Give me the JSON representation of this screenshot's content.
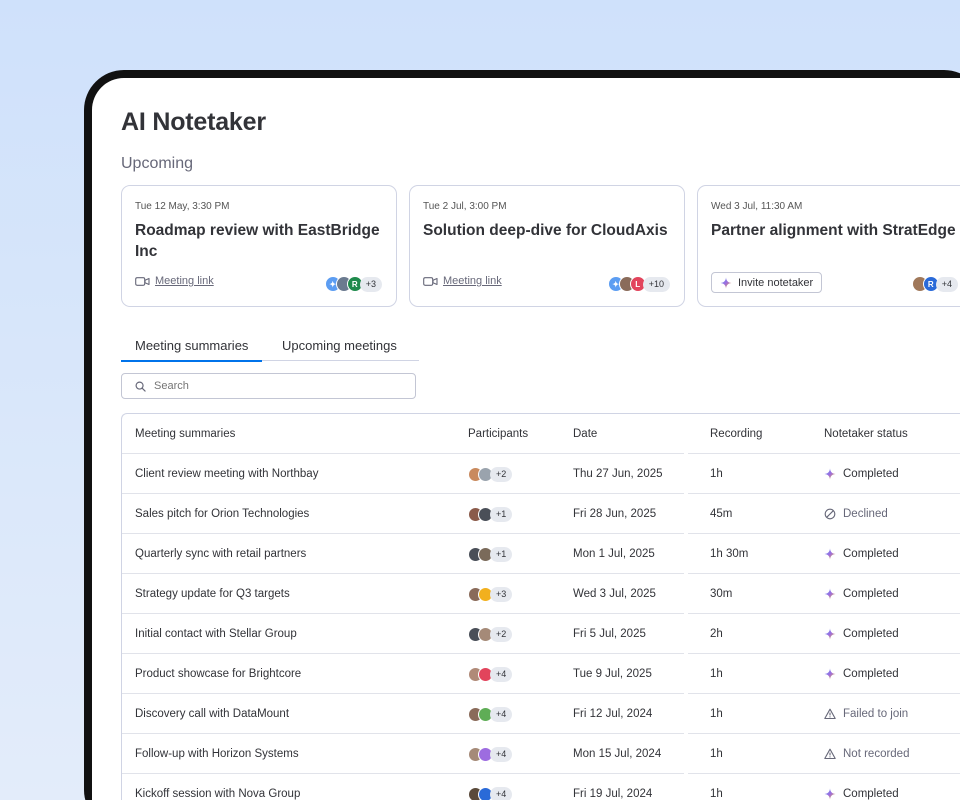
{
  "app": {
    "title": "AI Notetaker"
  },
  "upcoming": {
    "label": "Upcoming",
    "cards": [
      {
        "when": "Tue 12 May, 3:30 PM",
        "name": "Roadmap review with EastBridge Inc",
        "action": "Meeting link",
        "action_type": "link",
        "extra": "+3",
        "avatars": [
          {
            "bg": "#5c9df2",
            "t": "✦"
          },
          {
            "bg": "#6b7a8f",
            "t": ""
          },
          {
            "bg": "#1f8a4c",
            "t": "R"
          }
        ]
      },
      {
        "when": "Tue 2 Jul, 3:00 PM",
        "name": "Solution deep-dive for CloudAxis",
        "action": "Meeting link",
        "action_type": "link",
        "extra": "+10",
        "avatars": [
          {
            "bg": "#5c9df2",
            "t": "✦"
          },
          {
            "bg": "#8a6b5a",
            "t": ""
          },
          {
            "bg": "#e2445c",
            "t": "L"
          }
        ]
      },
      {
        "when": "Wed 3 Jul, 11:30 AM",
        "name": "Partner alignment with StratEdge",
        "action": "Invite notetaker",
        "action_type": "invite",
        "extra": "+4",
        "avatars": [
          {
            "bg": "#a0785a",
            "t": ""
          },
          {
            "bg": "#2a6ad8",
            "t": "R"
          }
        ]
      }
    ]
  },
  "tabs": [
    {
      "label": "Meeting summaries",
      "active": true
    },
    {
      "label": "Upcoming meetings",
      "active": false
    }
  ],
  "search": {
    "placeholder": "Search"
  },
  "table": {
    "headers": {
      "name": "Meeting summaries",
      "participants": "Participants",
      "date": "Date",
      "recording": "Recording",
      "status": "Notetaker status"
    },
    "rows": [
      {
        "name": "Client review meeting with Northbay",
        "extra": "+2",
        "date": "Thu 27 Jun, 2025",
        "recording": "1h",
        "status": "Completed",
        "icon": "sparkle-icon",
        "avatars": [
          "#c98a5e",
          "#9aa3ad"
        ]
      },
      {
        "name": "Sales pitch for Orion Technologies",
        "extra": "+1",
        "date": "Fri 28 Jun, 2025",
        "recording": "45m",
        "status": "Declined",
        "icon": "declined-icon",
        "avatars": [
          "#8a5a4a",
          "#4a4f58"
        ]
      },
      {
        "name": "Quarterly sync with retail partners",
        "extra": "+1",
        "date": "Mon 1 Jul, 2025",
        "recording": "1h 30m",
        "status": "Completed",
        "icon": "sparkle-icon",
        "avatars": [
          "#4a4f58",
          "#7a6a5a"
        ]
      },
      {
        "name": "Strategy update for Q3 targets",
        "extra": "+3",
        "date": "Wed 3 Jul, 2025",
        "recording": "30m",
        "status": "Completed",
        "icon": "sparkle-icon",
        "avatars": [
          "#8a6b5a",
          "#f2b01e"
        ]
      },
      {
        "name": "Initial contact with Stellar Group",
        "extra": "+2",
        "date": "Fri 5 Jul, 2025",
        "recording": "2h",
        "status": "Completed",
        "icon": "sparkle-icon",
        "avatars": [
          "#4a4f58",
          "#a58a78"
        ]
      },
      {
        "name": "Product showcase for Brightcore",
        "extra": "+4",
        "date": "Tue 9 Jul, 2025",
        "recording": "1h",
        "status": "Completed",
        "icon": "sparkle-icon",
        "avatars": [
          "#b08a78",
          "#e2445c"
        ]
      },
      {
        "name": "Discovery call with DataMount",
        "extra": "+4",
        "date": "Fri 12 Jul, 2024",
        "recording": "1h",
        "status": "Failed to join",
        "icon": "warning-icon",
        "avatars": [
          "#8a6b5a",
          "#5fad56"
        ]
      },
      {
        "name": "Follow-up with Horizon Systems",
        "extra": "+4",
        "date": "Mon 15 Jul, 2024",
        "recording": "1h",
        "status": "Not recorded",
        "icon": "warning-icon",
        "avatars": [
          "#a58a78",
          "#9d6ce0"
        ]
      },
      {
        "name": "Kickoff session with Nova Group",
        "extra": "+4",
        "date": "Fri 19 Jul, 2024",
        "recording": "1h",
        "status": "Completed",
        "icon": "sparkle-icon",
        "avatars": [
          "#5a4a3a",
          "#2a6ad8"
        ]
      }
    ]
  },
  "colors": {
    "accent": "#0073ea",
    "border": "#d0d4e4",
    "muted": "#676879"
  }
}
